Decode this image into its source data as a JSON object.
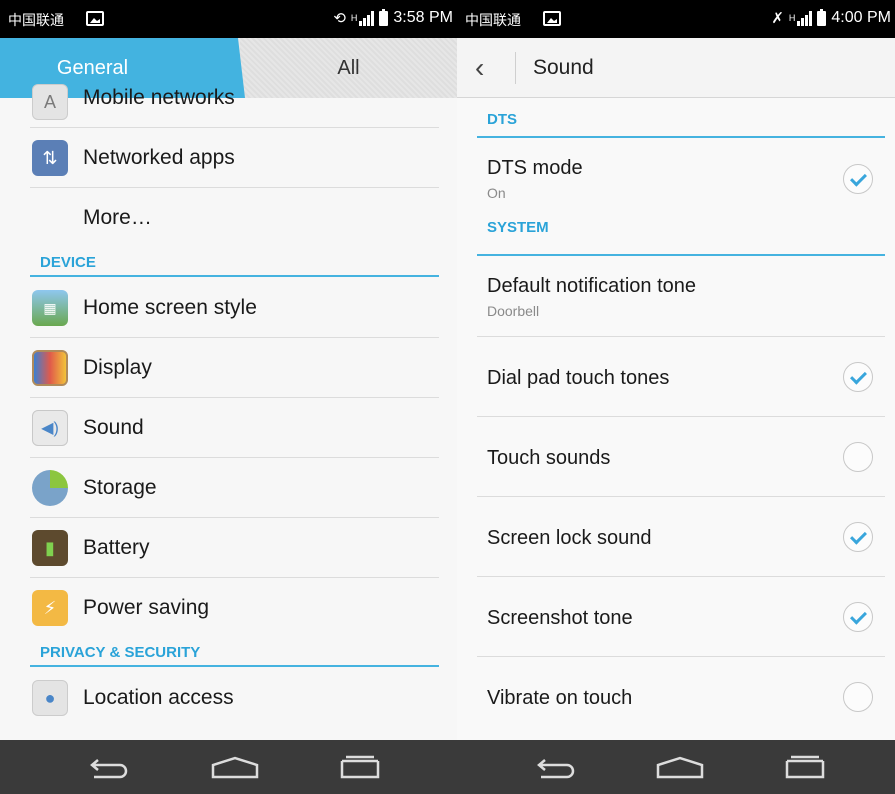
{
  "left": {
    "status": {
      "carrier": "中国联通",
      "time": "3:58 PM",
      "net": "H"
    },
    "tabs": {
      "general": "General",
      "all": "All"
    },
    "items_top": [
      {
        "label": "Mobile networks",
        "icon": "antenna-icon"
      },
      {
        "label": "Networked apps",
        "icon": "network-apps-icon"
      },
      {
        "label": "More…",
        "icon": ""
      }
    ],
    "device": {
      "title": "DEVICE",
      "items": [
        {
          "label": "Home screen style",
          "icon": "home-screen-icon"
        },
        {
          "label": "Display",
          "icon": "display-icon"
        },
        {
          "label": "Sound",
          "icon": "speaker-icon"
        },
        {
          "label": "Storage",
          "icon": "storage-pie-icon"
        },
        {
          "label": "Battery",
          "icon": "battery-icon"
        },
        {
          "label": "Power saving",
          "icon": "power-saving-icon"
        }
      ]
    },
    "privacy": {
      "title": "PRIVACY & SECURITY",
      "items": [
        {
          "label": "Location access",
          "icon": "location-pin-icon"
        }
      ]
    }
  },
  "right": {
    "status": {
      "carrier": "中国联通",
      "time": "4:00 PM",
      "net": "H"
    },
    "title": "Sound",
    "dts": {
      "title": "DTS",
      "mode_label": "DTS mode",
      "mode_value": "On",
      "mode_checked": true
    },
    "system": {
      "title": "SYSTEM",
      "notification_label": "Default notification tone",
      "notification_value": "Doorbell",
      "toggles": [
        {
          "label": "Dial pad touch tones",
          "checked": true
        },
        {
          "label": "Touch sounds",
          "checked": false
        },
        {
          "label": "Screen lock sound",
          "checked": true
        },
        {
          "label": "Screenshot tone",
          "checked": true
        },
        {
          "label": "Vibrate on touch",
          "checked": false
        }
      ]
    }
  },
  "colors": {
    "accent": "#45b3e0",
    "tab_active": "#43b3e0",
    "check": "#39a6dc",
    "navbar": "#3a3a3a"
  }
}
